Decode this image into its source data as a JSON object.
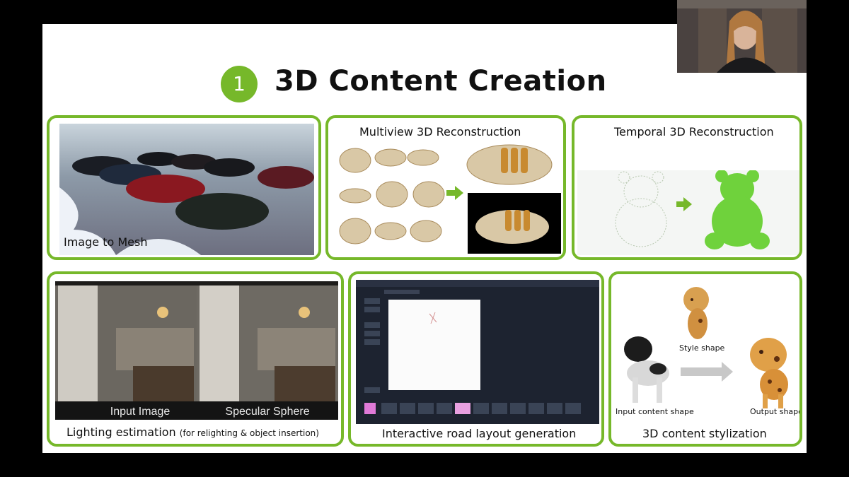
{
  "slide": {
    "number": "1",
    "title": "3D Content Creation",
    "accent_color": "#76b82a",
    "panels": {
      "image_to_mesh": {
        "caption": "Image to Mesh"
      },
      "multiview": {
        "caption": "Multiview 3D Reconstruction"
      },
      "temporal": {
        "caption": "Temporal 3D Reconstruction"
      },
      "lighting": {
        "caption": "Lighting estimation",
        "caption_note": "(for relighting & object insertion)",
        "label_left": "Input Image",
        "label_right": "Specular Sphere"
      },
      "road_layout": {
        "caption": "Interactive road layout generation"
      },
      "stylization": {
        "caption": "3D content stylization",
        "style_label": "Style shape",
        "input_label": "Input content shape",
        "output_label": "Output shape"
      }
    }
  },
  "icons": {
    "arrow": "right-arrow-icon"
  }
}
